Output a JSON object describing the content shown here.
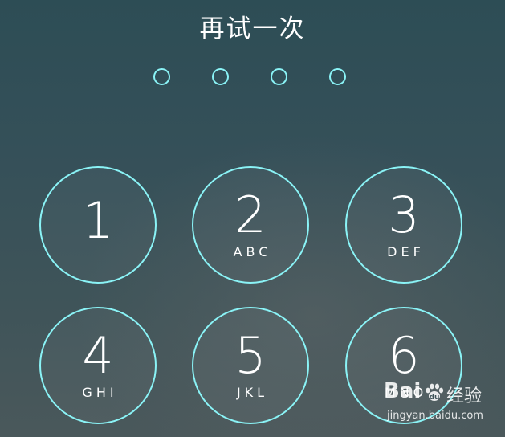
{
  "title": "再试一次",
  "passcode": {
    "total_digits": 4,
    "entered_digits": 0
  },
  "keypad": {
    "keys": [
      {
        "digit": "1",
        "letters": ""
      },
      {
        "digit": "2",
        "letters": "ABC"
      },
      {
        "digit": "3",
        "letters": "DEF"
      },
      {
        "digit": "4",
        "letters": "GHI"
      },
      {
        "digit": "5",
        "letters": "JKL"
      },
      {
        "digit": "6",
        "letters": "MNO"
      }
    ]
  },
  "colors": {
    "ring": "#8af3f6",
    "text": "#ffffff",
    "background": "#355059"
  },
  "watermark": {
    "brand": "Bai",
    "paw_icon": "paw-icon",
    "cn": "经验",
    "url": "jingyan.baidu.com"
  }
}
